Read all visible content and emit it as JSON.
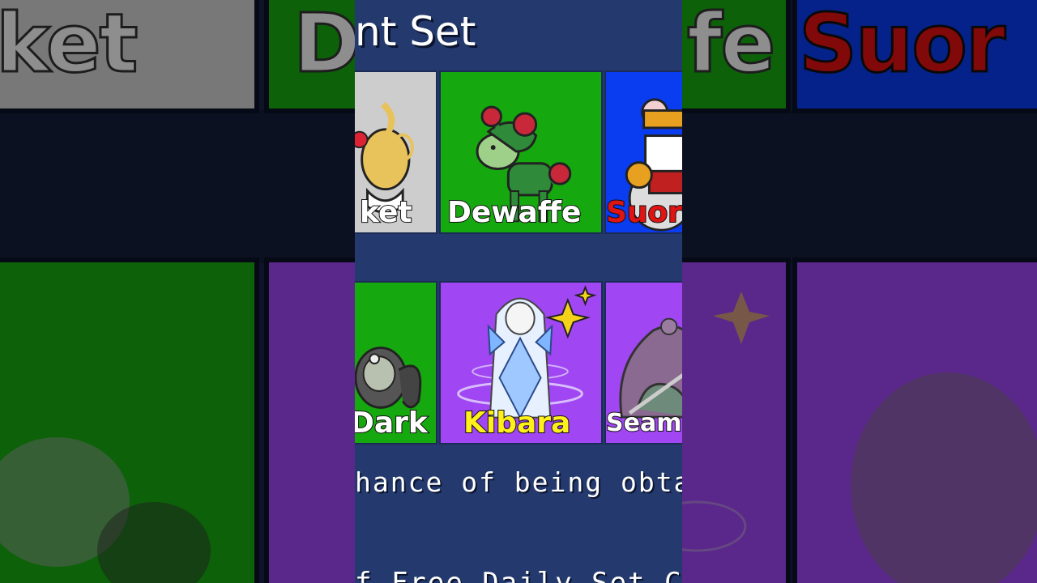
{
  "panel": {
    "title": "nt Set",
    "chance_text": "hance of being obtain",
    "bottom_text": "f Free Daily Set Ch"
  },
  "cards_row1": [
    {
      "name": "ket",
      "bg": "#cdcdcd",
      "name_color": "white"
    },
    {
      "name": "Dewaffe",
      "bg": "#16a80f",
      "name_color": "white"
    },
    {
      "name": "Suor",
      "bg": "#0a3cf0",
      "name_color": "red"
    }
  ],
  "cards_row2": [
    {
      "name": "Dark",
      "bg": "#16a80f",
      "name_color": "white"
    },
    {
      "name": "Kibara",
      "bg": "#a046f2",
      "name_color": "yellow"
    },
    {
      "name": "Seam",
      "bg": "#a046f2",
      "name_color": "white"
    }
  ],
  "background": {
    "tile_texts": [
      "ket",
      "D",
      "fe",
      "Suor"
    ]
  },
  "colors": {
    "panel": "#243a6e",
    "gray_card": "#cdcdcd",
    "green_card": "#16a80f",
    "blue_card": "#0a3cf0",
    "purple_card": "#a046f2"
  }
}
